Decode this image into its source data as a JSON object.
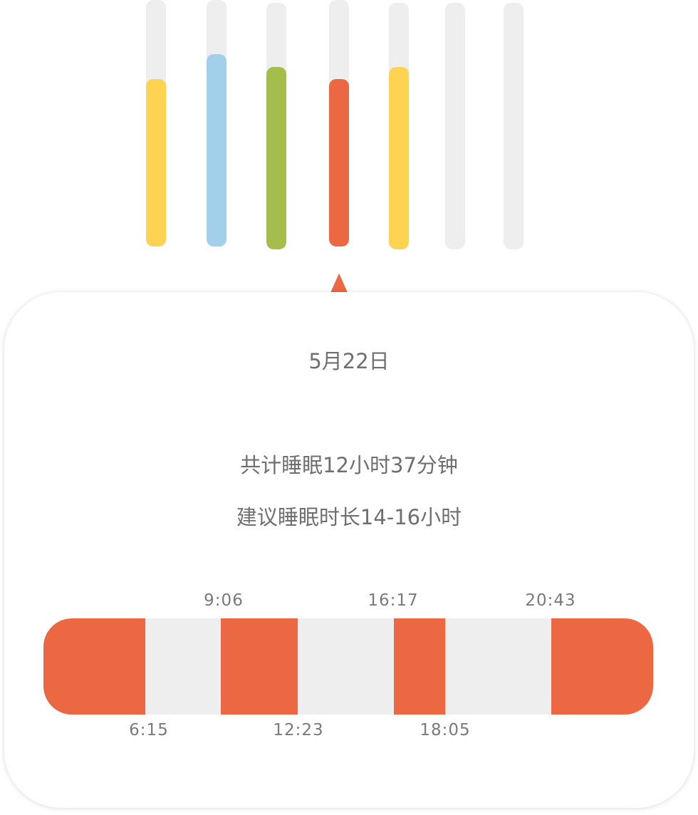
{
  "colors": {
    "track": "#eeeeee",
    "yellow": "#fdd351",
    "blue": "#a2d0ea",
    "green": "#a5bd4b",
    "orange": "#ec6843",
    "text": "#6f6f6f"
  },
  "week": [
    {
      "level": 0.68,
      "color": "#fdd351"
    },
    {
      "level": 0.78,
      "color": "#a2d0ea"
    },
    {
      "level": 0.74,
      "color": "#a5bd4b"
    },
    {
      "level": 0.68,
      "color": "#ec6843"
    },
    {
      "level": 0.74,
      "color": "#fdd351"
    },
    {
      "level": 0,
      "color": "#eeeeee"
    },
    {
      "level": 0,
      "color": "#eeeeee"
    }
  ],
  "selected_day_index": 3,
  "detail": {
    "date": "5月22日",
    "total_sleep": "共计睡眠12小时37分钟",
    "recommended": "建议睡眠时长14-16小时"
  },
  "timeline": {
    "sleep_color": "#ec6843",
    "labels_top": [
      "9:06",
      "16:17",
      "20:43"
    ],
    "labels_bottom": [
      "6:15",
      "12:23",
      "18:05"
    ]
  }
}
